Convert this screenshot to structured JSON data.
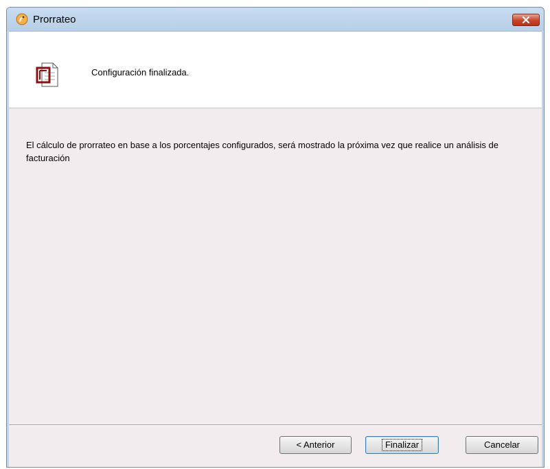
{
  "window": {
    "title": "Prorrateo",
    "app_icon": "app-logo-icon",
    "close_icon": "close-icon"
  },
  "header": {
    "icon": "document-icon",
    "text": "Configuración finalizada."
  },
  "content": {
    "message": "El cálculo de prorrateo en base a los porcentajes configurados, será mostrado la próxima vez que realice un análisis de facturación"
  },
  "buttons": {
    "previous": "< Anterior",
    "finish": "Finalizar",
    "cancel": "Cancelar"
  },
  "colors": {
    "window_bg": "#f3ecef",
    "titlebar": "#c9dcf1",
    "close_button": "#c8442a"
  }
}
